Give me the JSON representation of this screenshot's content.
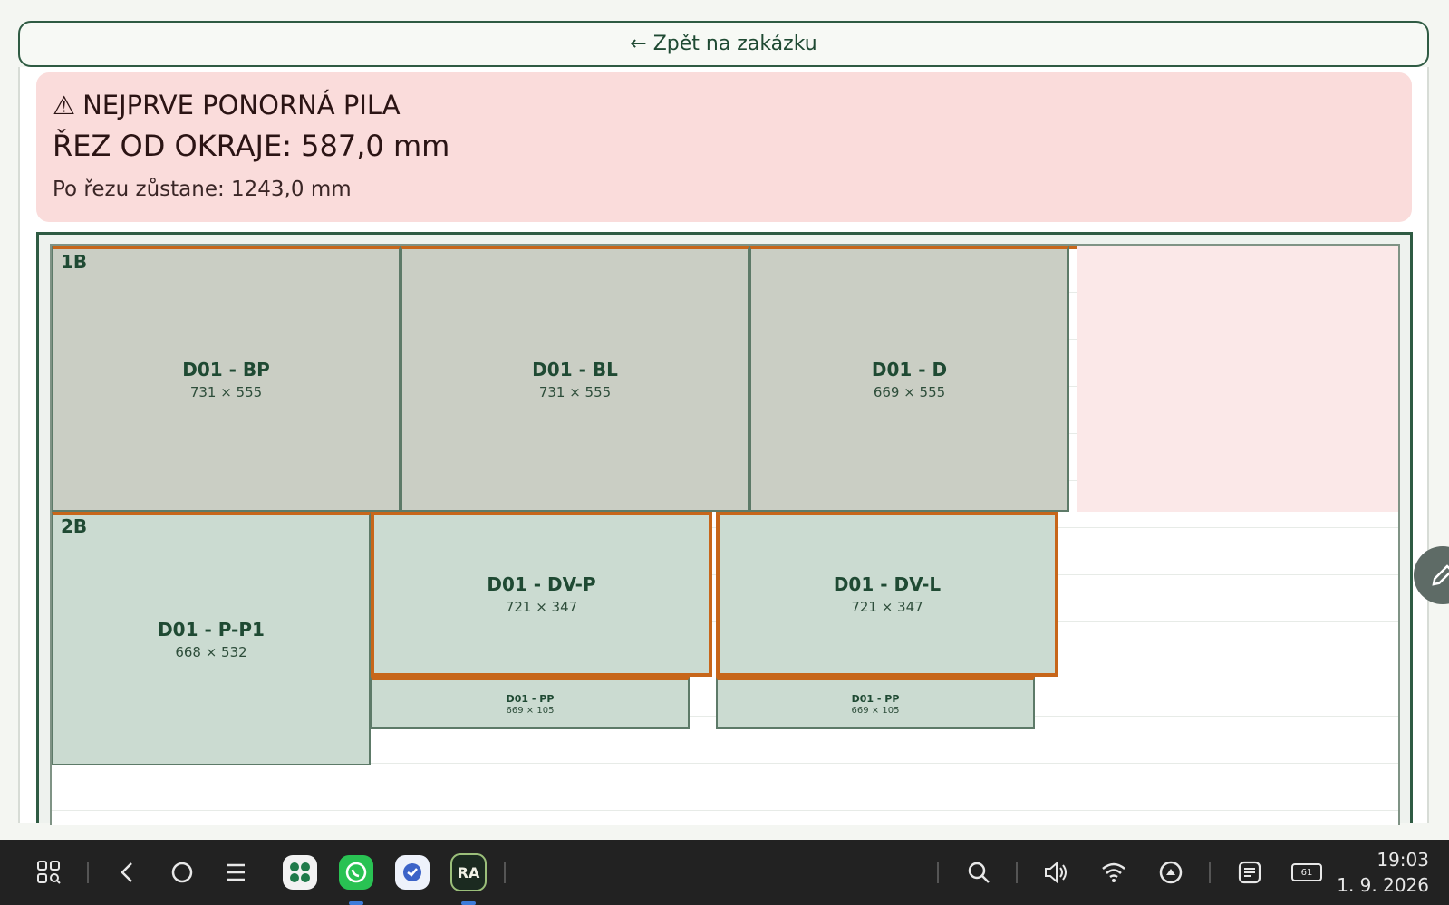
{
  "back_button": {
    "label": "← Zpět na zakázku"
  },
  "warning": {
    "icon": "warning-triangle-icon",
    "title": "NEJPRVE PONORNÁ PILA",
    "cut": "ŘEZ OD OKRAJE: 587,0 mm",
    "remaining": "Po řezu zůstane: 1243,0 mm",
    "background_color": "#fadcdb"
  },
  "board": {
    "strips": [
      {
        "label": "1B",
        "pieces": [
          {
            "name": "D01 - BP",
            "dims": "731 × 555"
          },
          {
            "name": "D01 - BL",
            "dims": "731 × 555"
          },
          {
            "name": "D01 - D",
            "dims": "669 × 555"
          }
        ]
      },
      {
        "label": "2B",
        "pieces": [
          {
            "name": "D01 - P-P1",
            "dims": "668 × 532"
          },
          {
            "name": "D01 - DV-P",
            "dims": "721 × 347"
          },
          {
            "name": "D01 - DV-L",
            "dims": "721 × 347"
          },
          {
            "name": "D01 - PP",
            "dims": "669 × 105"
          },
          {
            "name": "D01 - PP",
            "dims": "669 × 105"
          }
        ]
      }
    ],
    "colors": {
      "accent": "#c7661a",
      "frame": "#2f5b43",
      "piece_grey": "#cacec4",
      "piece_green": "#cbdbd1",
      "waste": "#fbe8e8"
    }
  },
  "taskbar": {
    "icons": [
      "app-drawer-icon",
      "back-icon",
      "home-icon",
      "recents-icon",
      "search-icon",
      "volume-icon",
      "wifi-icon",
      "upload-icon",
      "notes-icon",
      "battery-icon"
    ],
    "apps": [
      "calculator-app-icon",
      "whatsapp-app-icon",
      "clock-app-icon",
      "ra-app-icon"
    ],
    "app_ra_label": "RA",
    "battery": "61",
    "time": "19:03",
    "date": "1. 9. 2026"
  }
}
